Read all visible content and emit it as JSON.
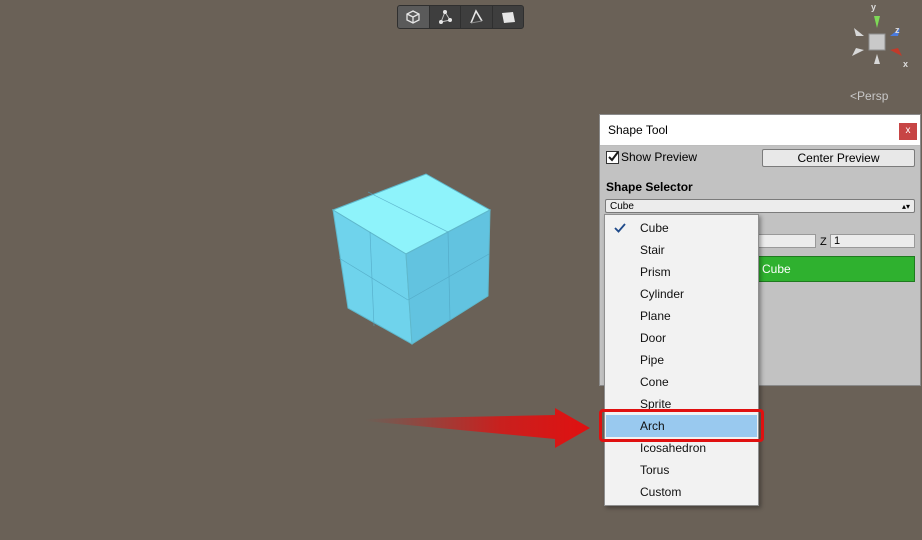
{
  "scene": {
    "gizmo": {
      "y_label": "y",
      "z_label": "z",
      "x_label": "x"
    },
    "persp_label": "Persp"
  },
  "toolbar": {
    "buttons": [
      "object-mode-icon",
      "vertex-mode-icon",
      "edge-mode-icon",
      "face-mode-icon"
    ]
  },
  "shape_tool": {
    "title": "Shape Tool",
    "close_label": "x",
    "show_preview_label": "Show Preview",
    "show_preview_checked": true,
    "center_preview_label": "Center Preview",
    "shape_selector_label": "Shape Selector",
    "selected_shape": "Cube",
    "z_label": "Z",
    "z_value": "1",
    "build_button_label": "Cube"
  },
  "dropdown": {
    "items": [
      {
        "label": "Cube",
        "checked": true
      },
      {
        "label": "Stair"
      },
      {
        "label": "Prism"
      },
      {
        "label": "Cylinder"
      },
      {
        "label": "Plane"
      },
      {
        "label": "Door"
      },
      {
        "label": "Pipe"
      },
      {
        "label": "Cone"
      },
      {
        "label": "Sprite"
      },
      {
        "label": "Arch",
        "highlighted": true
      },
      {
        "label": "Icosahedron"
      },
      {
        "label": "Torus"
      },
      {
        "label": "Custom"
      }
    ]
  },
  "colors": {
    "scene_bg": "#6a6157",
    "cube_face": "#7de8f5",
    "build_button": "#2fb12f",
    "highlight": "#99c9ef",
    "callout": "#e01010"
  }
}
